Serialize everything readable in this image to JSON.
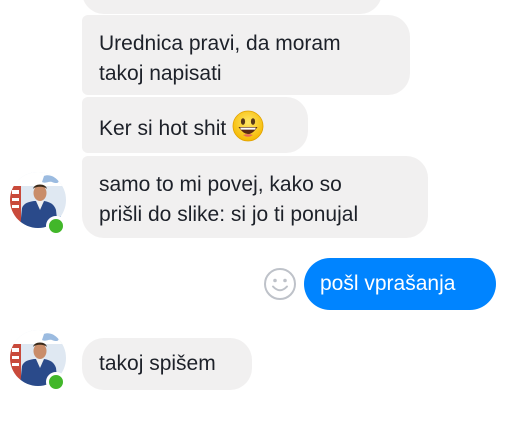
{
  "conversation": {
    "incoming": [
      {
        "text": ""
      },
      {
        "text": "Urednica pravi, da moram\ntakoj napisati"
      },
      {
        "text": "Ker si hot shit",
        "emoji": "grinning-face-emoji"
      },
      {
        "text": "samo to mi povej, kako so\nprišli do slike: si jo ti ponujal"
      },
      {
        "text": "takoj spišem"
      }
    ],
    "outgoing": [
      {
        "text": "pošl vprašanja"
      }
    ]
  },
  "icons": {
    "reaction": "smiley-outline-icon",
    "status": "online-status-dot"
  },
  "colors": {
    "incoming_bubble": "#f1f0f0",
    "outgoing_bubble": "#0084ff",
    "online": "#42b72a",
    "text": "#1d2129"
  }
}
